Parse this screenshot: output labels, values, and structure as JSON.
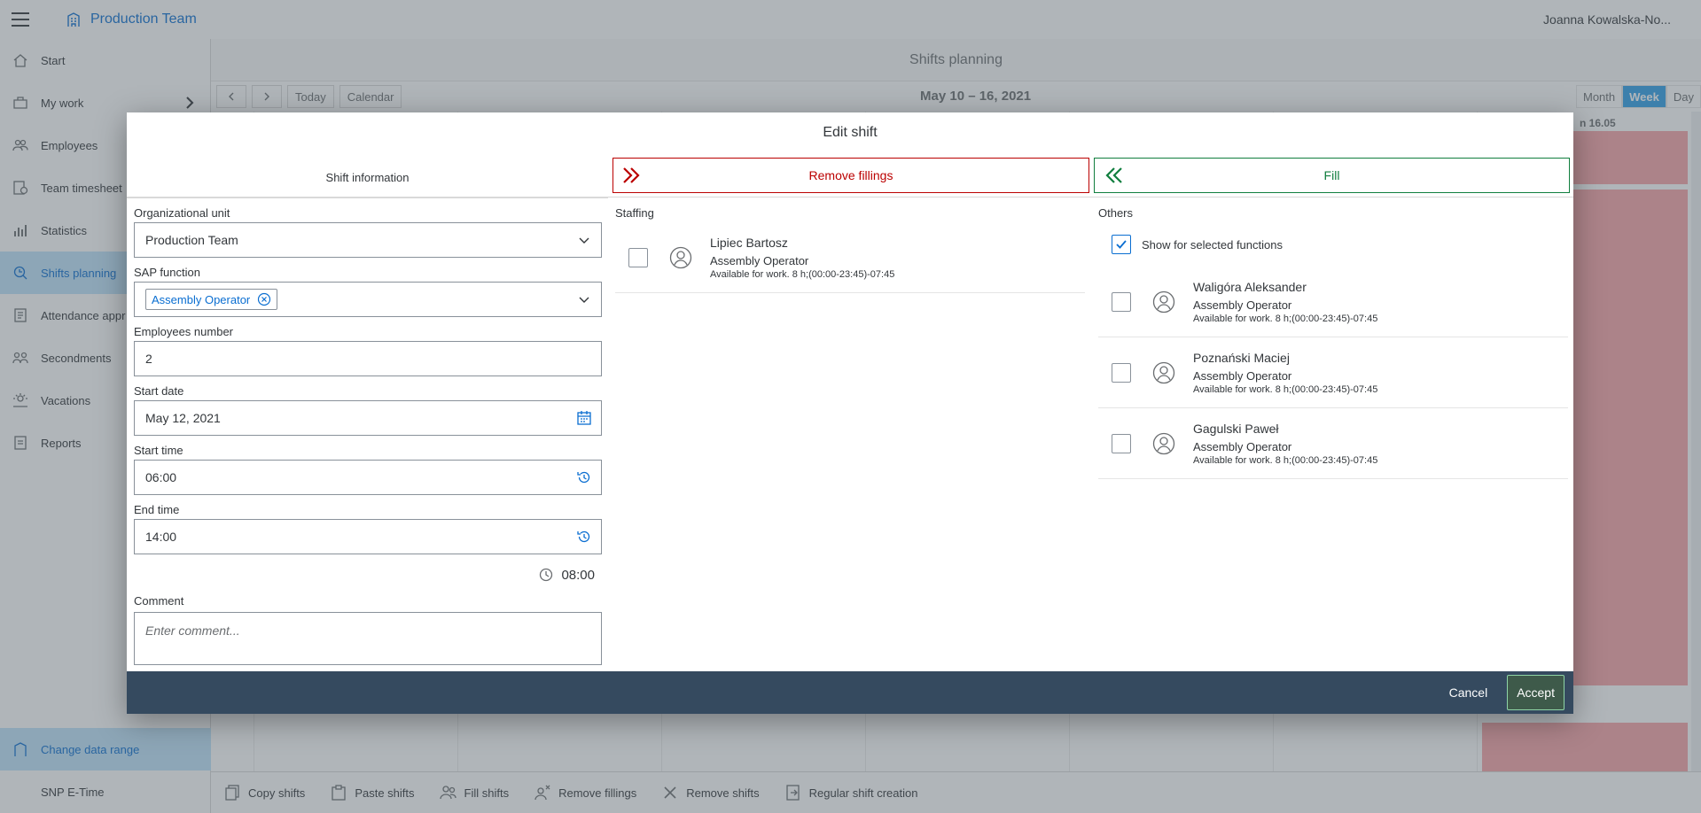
{
  "header": {
    "brand": "Production Team",
    "user": "Joanna Kowalska-No..."
  },
  "sidebar": {
    "items": [
      {
        "label": "Start",
        "icon": "home-icon"
      },
      {
        "label": "My work",
        "icon": "briefcase-icon"
      },
      {
        "label": "Employees",
        "icon": "employees-icon"
      },
      {
        "label": "Team timesheet",
        "icon": "timesheet-icon"
      },
      {
        "label": "Statistics",
        "icon": "statistics-icon"
      },
      {
        "label": "Shifts planning",
        "icon": "shifts-planning-icon"
      },
      {
        "label": "Attendance appr",
        "icon": "attendance-icon"
      },
      {
        "label": "Secondments",
        "icon": "secondments-icon"
      },
      {
        "label": "Vacations",
        "icon": "vacations-icon"
      },
      {
        "label": "Reports",
        "icon": "reports-icon"
      }
    ],
    "change_range": "Change data range",
    "version": "SNP E-Time"
  },
  "main": {
    "title": "Shifts planning",
    "toolbar": {
      "today": "Today",
      "calendar": "Calendar"
    },
    "range": "May 10 – 16, 2021",
    "views": [
      "Month",
      "Week",
      "Day"
    ],
    "day_header": "n 16.05"
  },
  "bottom_toolbar": {
    "copy": "Copy shifts",
    "paste": "Paste shifts",
    "fill": "Fill shifts",
    "remove_fillings": "Remove fillings",
    "remove": "Remove shifts",
    "regular": "Regular shift creation"
  },
  "dialog": {
    "title": "Edit shift",
    "tabs": {
      "info": "Shift information",
      "remove": "Remove fillings",
      "fill": "Fill"
    },
    "form": {
      "org_unit_label": "Organizational unit",
      "org_unit_value": "Production Team",
      "sap_function_label": "SAP function",
      "sap_function_token": "Assembly Operator",
      "employees_label": "Employees number",
      "employees_value": "2",
      "start_date_label": "Start date",
      "start_date_value": "May 12, 2021",
      "start_time_label": "Start time",
      "start_time_value": "06:00",
      "end_time_label": "End time",
      "end_time_value": "14:00",
      "duration": "08:00",
      "comment_label": "Comment",
      "comment_placeholder": "Enter comment..."
    },
    "staffing": {
      "title": "Staffing",
      "people": [
        {
          "name": "Lipiec Bartosz",
          "function": "Assembly Operator",
          "availability": "Available for work. 8 h;(00:00-23:45)-07:45"
        }
      ]
    },
    "others": {
      "title": "Others",
      "show_selected": "Show for selected functions",
      "people": [
        {
          "name": "Waligóra Aleksander",
          "function": "Assembly Operator",
          "availability": "Available for work. 8 h;(00:00-23:45)-07:45"
        },
        {
          "name": "Poznański Maciej",
          "function": "Assembly Operator",
          "availability": "Available for work. 8 h;(00:00-23:45)-07:45"
        },
        {
          "name": "Gagulski Paweł",
          "function": "Assembly Operator",
          "availability": "Available for work. 8 h;(00:00-23:45)-07:45"
        }
      ]
    },
    "footer": {
      "cancel": "Cancel",
      "accept": "Accept"
    }
  }
}
